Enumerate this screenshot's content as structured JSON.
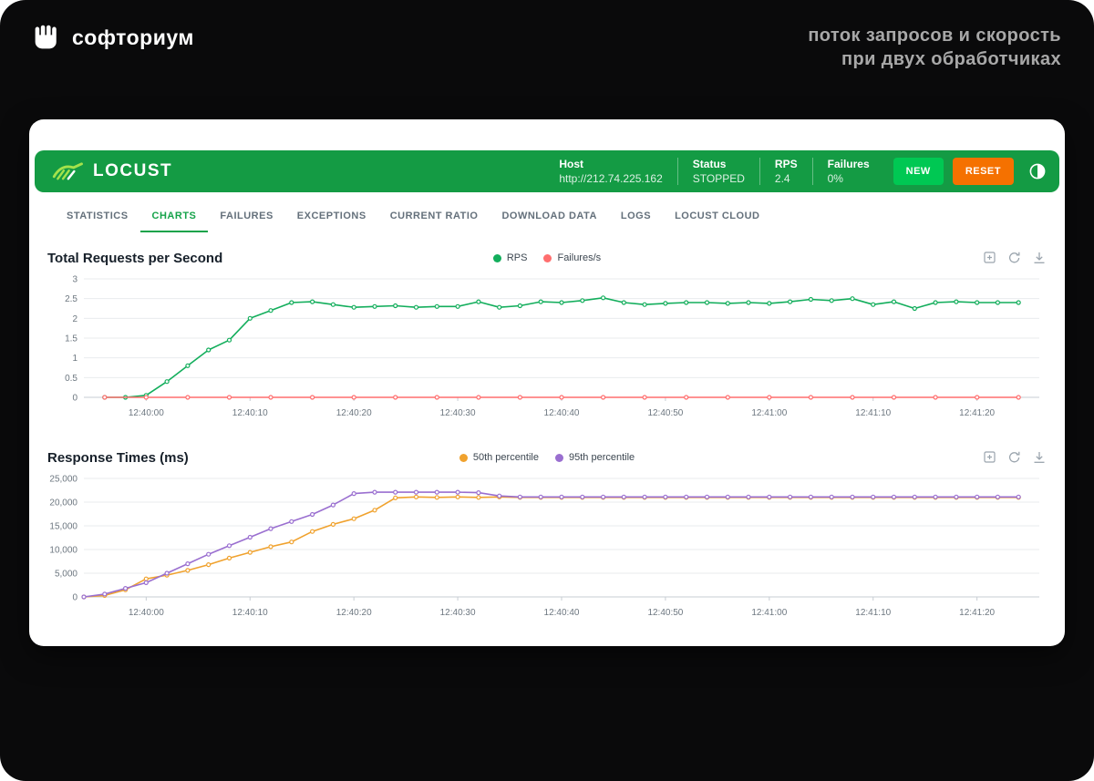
{
  "banner": {
    "brand": "софториум",
    "tagline_line1": "поток запросов и скорость",
    "tagline_line2": "при двух обработчиках"
  },
  "header": {
    "brand": "LOCUST",
    "host_label": "Host",
    "host_value": "http://212.74.225.162",
    "status_label": "Status",
    "status_value": "STOPPED",
    "rps_label": "RPS",
    "rps_value": "2.4",
    "failures_label": "Failures",
    "failures_value": "0%",
    "new_button": "NEW",
    "reset_button": "RESET",
    "colors": {
      "header_bg": "#149b44",
      "new_bg": "#00c853",
      "reset_bg": "#f57100"
    }
  },
  "icons": {
    "brand_logo": "fist-icon",
    "locust_logo": "locust-swarm-icon",
    "theme_toggle": "contrast-icon",
    "chart_tools": [
      "drag-zoom-icon",
      "reset-zoom-icon",
      "save-image-icon"
    ]
  },
  "tabs": [
    {
      "label": "STATISTICS",
      "active": false
    },
    {
      "label": "CHARTS",
      "active": true
    },
    {
      "label": "FAILURES",
      "active": false
    },
    {
      "label": "EXCEPTIONS",
      "active": false
    },
    {
      "label": "CURRENT RATIO",
      "active": false
    },
    {
      "label": "DOWNLOAD DATA",
      "active": false
    },
    {
      "label": "LOGS",
      "active": false
    },
    {
      "label": "LOCUST CLOUD",
      "active": false
    }
  ],
  "chart_data": [
    {
      "id": "total-requests-per-second",
      "type": "line",
      "title": "Total Requests per Second",
      "legend": [
        {
          "name": "RPS",
          "color": "#13ae5c"
        },
        {
          "name": "Failures/s",
          "color": "#ff6e6e"
        }
      ],
      "ylim": [
        0,
        3
      ],
      "y_ticks": [
        {
          "v": 0,
          "label": "0"
        },
        {
          "v": 0.5,
          "label": "0.5"
        },
        {
          "v": 1,
          "label": "1"
        },
        {
          "v": 1.5,
          "label": "1.5"
        },
        {
          "v": 2,
          "label": "2"
        },
        {
          "v": 2.5,
          "label": "2.5"
        },
        {
          "v": 3,
          "label": "3"
        }
      ],
      "x_domain": [
        0,
        92
      ],
      "x_ticks": [
        {
          "t": 6,
          "label": "12:40:00"
        },
        {
          "t": 16,
          "label": "12:40:10"
        },
        {
          "t": 26,
          "label": "12:40:20"
        },
        {
          "t": 36,
          "label": "12:40:30"
        },
        {
          "t": 46,
          "label": "12:40:40"
        },
        {
          "t": 56,
          "label": "12:40:50"
        },
        {
          "t": 66,
          "label": "12:41:00"
        },
        {
          "t": 76,
          "label": "12:41:10"
        },
        {
          "t": 86,
          "label": "12:41:20"
        }
      ],
      "series": [
        {
          "name": "RPS",
          "color": "#13ae5c",
          "points": [
            [
              2,
              0
            ],
            [
              4,
              0
            ],
            [
              6,
              0.05
            ],
            [
              8,
              0.4
            ],
            [
              10,
              0.8
            ],
            [
              12,
              1.2
            ],
            [
              14,
              1.45
            ],
            [
              16,
              2.0
            ],
            [
              18,
              2.2
            ],
            [
              20,
              2.4
            ],
            [
              22,
              2.42
            ],
            [
              24,
              2.35
            ],
            [
              26,
              2.28
            ],
            [
              28,
              2.3
            ],
            [
              30,
              2.32
            ],
            [
              32,
              2.28
            ],
            [
              34,
              2.3
            ],
            [
              36,
              2.3
            ],
            [
              38,
              2.42
            ],
            [
              40,
              2.28
            ],
            [
              42,
              2.32
            ],
            [
              44,
              2.42
            ],
            [
              46,
              2.4
            ],
            [
              48,
              2.45
            ],
            [
              50,
              2.52
            ],
            [
              52,
              2.4
            ],
            [
              54,
              2.35
            ],
            [
              56,
              2.38
            ],
            [
              58,
              2.4
            ],
            [
              60,
              2.4
            ],
            [
              62,
              2.38
            ],
            [
              64,
              2.4
            ],
            [
              66,
              2.38
            ],
            [
              68,
              2.42
            ],
            [
              70,
              2.48
            ],
            [
              72,
              2.45
            ],
            [
              74,
              2.5
            ],
            [
              76,
              2.35
            ],
            [
              78,
              2.42
            ],
            [
              80,
              2.25
            ],
            [
              82,
              2.4
            ],
            [
              84,
              2.42
            ],
            [
              86,
              2.4
            ],
            [
              88,
              2.4
            ],
            [
              90,
              2.4
            ]
          ]
        },
        {
          "name": "Failures/s",
          "color": "#ff6e6e",
          "points": [
            [
              2,
              0
            ],
            [
              6,
              0
            ],
            [
              10,
              0
            ],
            [
              14,
              0
            ],
            [
              18,
              0
            ],
            [
              22,
              0
            ],
            [
              26,
              0
            ],
            [
              30,
              0
            ],
            [
              34,
              0
            ],
            [
              38,
              0
            ],
            [
              42,
              0
            ],
            [
              46,
              0
            ],
            [
              50,
              0
            ],
            [
              54,
              0
            ],
            [
              58,
              0
            ],
            [
              62,
              0
            ],
            [
              66,
              0
            ],
            [
              70,
              0
            ],
            [
              74,
              0
            ],
            [
              78,
              0
            ],
            [
              82,
              0
            ],
            [
              86,
              0
            ],
            [
              90,
              0
            ]
          ]
        }
      ]
    },
    {
      "id": "response-times-ms",
      "type": "line",
      "title": "Response Times (ms)",
      "legend": [
        {
          "name": "50th percentile",
          "color": "#f0a22e"
        },
        {
          "name": "95th percentile",
          "color": "#9a6fd0"
        }
      ],
      "ylim": [
        0,
        25000
      ],
      "y_ticks": [
        {
          "v": 0,
          "label": "0"
        },
        {
          "v": 5000,
          "label": "5,000"
        },
        {
          "v": 10000,
          "label": "10,000"
        },
        {
          "v": 15000,
          "label": "15,000"
        },
        {
          "v": 20000,
          "label": "20,000"
        },
        {
          "v": 25000,
          "label": "25,000"
        }
      ],
      "x_domain": [
        0,
        92
      ],
      "x_ticks": [
        {
          "t": 6,
          "label": "12:40:00"
        },
        {
          "t": 16,
          "label": "12:40:10"
        },
        {
          "t": 26,
          "label": "12:40:20"
        },
        {
          "t": 36,
          "label": "12:40:30"
        },
        {
          "t": 46,
          "label": "12:40:40"
        },
        {
          "t": 56,
          "label": "12:40:50"
        },
        {
          "t": 66,
          "label": "12:41:00"
        },
        {
          "t": 76,
          "label": "12:41:10"
        },
        {
          "t": 86,
          "label": "12:41:20"
        }
      ],
      "series": [
        {
          "name": "50th percentile",
          "color": "#f0a22e",
          "points": [
            [
              0,
              0
            ],
            [
              2,
              300
            ],
            [
              4,
              1500
            ],
            [
              6,
              3800
            ],
            [
              8,
              4600
            ],
            [
              10,
              5600
            ],
            [
              12,
              6800
            ],
            [
              14,
              8200
            ],
            [
              16,
              9400
            ],
            [
              18,
              10600
            ],
            [
              20,
              11600
            ],
            [
              22,
              13800
            ],
            [
              24,
              15300
            ],
            [
              26,
              16500
            ],
            [
              28,
              18300
            ],
            [
              30,
              20900
            ],
            [
              32,
              21100
            ],
            [
              34,
              21000
            ],
            [
              36,
              21100
            ],
            [
              38,
              21000
            ],
            [
              40,
              21100
            ],
            [
              42,
              21000
            ],
            [
              44,
              21000
            ],
            [
              46,
              21000
            ],
            [
              48,
              21000
            ],
            [
              50,
              21000
            ],
            [
              52,
              21000
            ],
            [
              54,
              21000
            ],
            [
              56,
              21000
            ],
            [
              58,
              21000
            ],
            [
              60,
              21000
            ],
            [
              62,
              21000
            ],
            [
              64,
              21000
            ],
            [
              66,
              21000
            ],
            [
              68,
              21000
            ],
            [
              70,
              21000
            ],
            [
              72,
              21000
            ],
            [
              74,
              21000
            ],
            [
              76,
              21000
            ],
            [
              78,
              21000
            ],
            [
              80,
              21000
            ],
            [
              82,
              21000
            ],
            [
              84,
              21000
            ],
            [
              86,
              21000
            ],
            [
              88,
              21000
            ],
            [
              90,
              21000
            ]
          ]
        },
        {
          "name": "95th percentile",
          "color": "#9a6fd0",
          "points": [
            [
              0,
              0
            ],
            [
              2,
              600
            ],
            [
              4,
              1800
            ],
            [
              6,
              3000
            ],
            [
              8,
              5000
            ],
            [
              10,
              7000
            ],
            [
              12,
              9000
            ],
            [
              14,
              10800
            ],
            [
              16,
              12600
            ],
            [
              18,
              14400
            ],
            [
              20,
              15900
            ],
            [
              22,
              17400
            ],
            [
              24,
              19400
            ],
            [
              26,
              21800
            ],
            [
              28,
              22100
            ],
            [
              30,
              22100
            ],
            [
              32,
              22100
            ],
            [
              34,
              22100
            ],
            [
              36,
              22100
            ],
            [
              38,
              22000
            ],
            [
              40,
              21300
            ],
            [
              42,
              21100
            ],
            [
              44,
              21100
            ],
            [
              46,
              21100
            ],
            [
              48,
              21100
            ],
            [
              50,
              21100
            ],
            [
              52,
              21100
            ],
            [
              54,
              21100
            ],
            [
              56,
              21100
            ],
            [
              58,
              21100
            ],
            [
              60,
              21100
            ],
            [
              62,
              21100
            ],
            [
              64,
              21100
            ],
            [
              66,
              21100
            ],
            [
              68,
              21100
            ],
            [
              70,
              21100
            ],
            [
              72,
              21100
            ],
            [
              74,
              21100
            ],
            [
              76,
              21100
            ],
            [
              78,
              21100
            ],
            [
              80,
              21100
            ],
            [
              82,
              21100
            ],
            [
              84,
              21100
            ],
            [
              86,
              21100
            ],
            [
              88,
              21100
            ],
            [
              90,
              21100
            ]
          ]
        }
      ]
    }
  ]
}
